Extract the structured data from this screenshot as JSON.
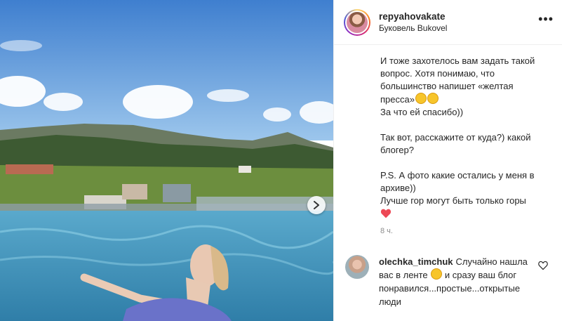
{
  "post": {
    "username": "repyahovakate",
    "location": "Буковель Bukovel",
    "more_label": "•••"
  },
  "caption": {
    "lines": [
      "И тоже захотелось вам задать такой вопрос. Хотя понимаю, что большинство напишет «желтая пресса»",
      "За что ей спасибо))",
      "Так вот, расскажите от куда?) какой блогер?",
      "P.S. А фото какие остались у меня в архиве))",
      "Лучше гор могут быть только горы"
    ]
  },
  "time": "8 ч.",
  "comment": {
    "username": "olechka_timchuk",
    "text_1": "Случайно нашла вас в ленте",
    "text_2": "и сразу ваш блог понравился...простые...открытые люди"
  },
  "icons": {
    "next": "chevron-right-icon",
    "more": "more-options-icon",
    "like": "heart-outline-icon",
    "emoji": "grinning-face-icon",
    "heart": "red-heart-icon"
  },
  "colors": {
    "sky": "#4f8fd6",
    "water": "#3e8fb8",
    "heart_red": "#ed4956",
    "muted": "#8e8e8e"
  }
}
